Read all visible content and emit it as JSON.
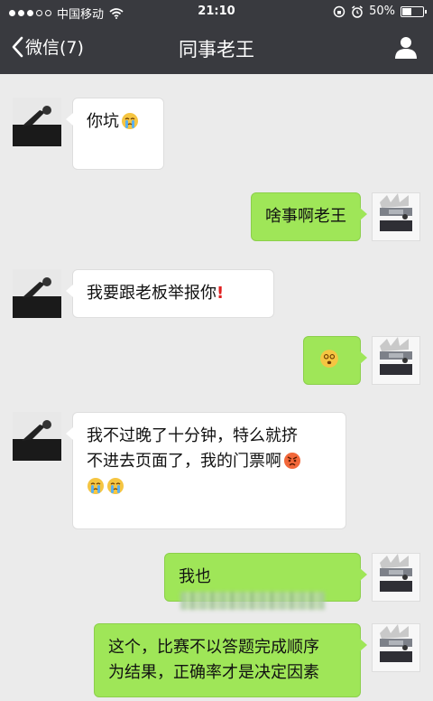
{
  "status_bar": {
    "carrier": "中国移动",
    "time": "21:10",
    "battery": "50%",
    "battery_level": 0.5
  },
  "nav": {
    "back_label": "微信(7)",
    "title": "同事老王"
  },
  "messages": [
    {
      "side": "in",
      "text": "你坑",
      "emojis": [
        "crying-emoji"
      ]
    },
    {
      "side": "out",
      "text": "啥事啊老王"
    },
    {
      "side": "in",
      "text": "我要跟老板举报你",
      "emojis": [
        "exclamation-mark"
      ]
    },
    {
      "side": "out",
      "text": "",
      "emojis": [
        "dizzy-face-emoji"
      ]
    },
    {
      "side": "in",
      "text_line1": "我不过晚了十分钟，特么就挤",
      "text_line2": "不进去页面了，我的门票啊",
      "emojis": [
        "angry-face-emoji",
        "crying-emoji",
        "crying-emoji"
      ]
    },
    {
      "side": "out",
      "text": "我也",
      "redacted": true
    },
    {
      "side": "out",
      "text_line1": "这个，比赛不以答题完成顺序",
      "text_line2": "为结果，正确率才是决定因素"
    }
  ],
  "colors": {
    "topbar": "#393a3f",
    "chat_bg": "#ebebeb",
    "bubble_out": "#9fe658",
    "bubble_in": "#ffffff"
  }
}
